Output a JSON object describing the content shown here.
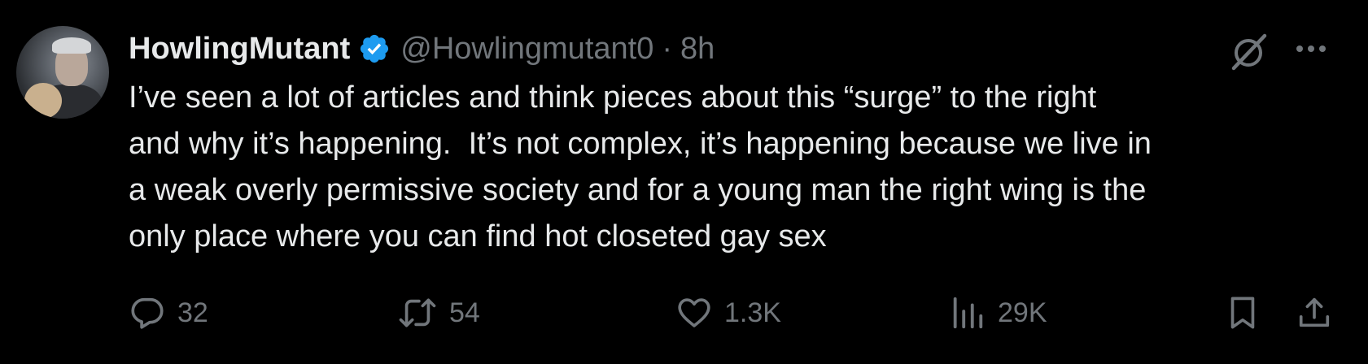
{
  "author": {
    "display_name": "HowlingMutant",
    "handle": "@Howlingmutant0",
    "separator": "·",
    "time": "8h",
    "verified": true,
    "avatar_icon": "user-avatar"
  },
  "tweet": {
    "text": "I’ve seen a lot of articles and think pieces about this “surge” to the right\nand why it’s happening.  It’s not complex, it’s happening because we live in\na weak overly permissive society and for a young man the right wing is the\nonly place where you can find hot closeted gay sex"
  },
  "actions": {
    "reply_count": "32",
    "retweet_count": "54",
    "like_count": "1.3K",
    "view_count": "29K"
  },
  "icons": {
    "verified": "verified-badge-icon",
    "grok": "grok-icon",
    "more": "more-icon",
    "reply": "reply-icon",
    "retweet": "retweet-icon",
    "like": "heart-icon",
    "views": "views-icon",
    "bookmark": "bookmark-icon",
    "share": "share-icon"
  },
  "colors": {
    "background": "#000000",
    "text": "#e7e9ea",
    "muted": "#71767b",
    "verified": "#1d9bf0"
  }
}
